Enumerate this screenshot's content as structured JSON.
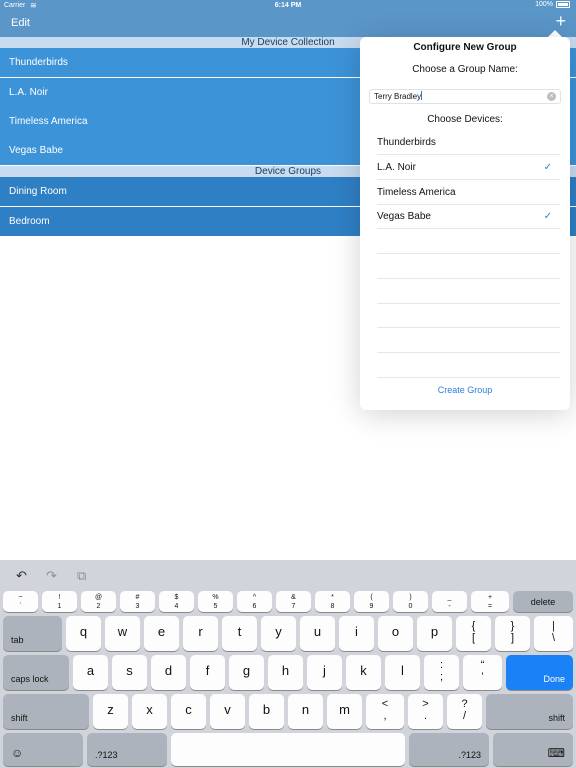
{
  "status_bar": {
    "carrier": "Carrier",
    "time": "6:14 PM",
    "battery": "100%"
  },
  "nav": {
    "edit_label": "Edit",
    "add_label": "+"
  },
  "list": {
    "sections": [
      {
        "header": "My Device Collection",
        "items": [
          "Thunderbirds",
          "L.A. Noir",
          "Timeless America",
          "Vegas Babe"
        ]
      },
      {
        "header": "Device Groups",
        "items": [
          "Dining Room",
          "Bedroom"
        ]
      }
    ]
  },
  "popover": {
    "title": "Configure New Group",
    "name_prompt": "Choose a Group Name:",
    "name_value": "Terry Bradley",
    "devices_prompt": "Choose Devices:",
    "devices": [
      {
        "label": "Thunderbirds",
        "checked": false
      },
      {
        "label": "L.A. Noir",
        "checked": true
      },
      {
        "label": "Timeless America",
        "checked": false
      },
      {
        "label": "Vegas Babe",
        "checked": true
      }
    ],
    "check_glyph": "✓",
    "create_label": "Create Group"
  },
  "keyboard": {
    "tools": {
      "undo_icon": "↶",
      "redo_icon": "↷",
      "paste_icon": "⧉"
    },
    "row1": [
      {
        "top": "~",
        "bot": "`"
      },
      {
        "top": "!",
        "bot": "1"
      },
      {
        "top": "@",
        "bot": "2"
      },
      {
        "top": "#",
        "bot": "3"
      },
      {
        "top": "$",
        "bot": "4"
      },
      {
        "top": "%",
        "bot": "5"
      },
      {
        "top": "^",
        "bot": "6"
      },
      {
        "top": "&",
        "bot": "7"
      },
      {
        "top": "*",
        "bot": "8"
      },
      {
        "top": "(",
        "bot": "9"
      },
      {
        "top": ")",
        "bot": "0"
      },
      {
        "top": "_",
        "bot": "-"
      },
      {
        "top": "+",
        "bot": "="
      }
    ],
    "delete_label": "delete",
    "tab_label": "tab",
    "row2": [
      "q",
      "w",
      "e",
      "r",
      "t",
      "y",
      "u",
      "i",
      "o",
      "p"
    ],
    "row2_sym": [
      {
        "top": "{",
        "bot": "["
      },
      {
        "top": "}",
        "bot": "]"
      },
      {
        "top": "|",
        "bot": "\\"
      }
    ],
    "caps_label": "caps lock",
    "row3": [
      "a",
      "s",
      "d",
      "f",
      "g",
      "h",
      "j",
      "k",
      "l"
    ],
    "row3_sym": [
      {
        "top": ":",
        "bot": ";"
      },
      {
        "top": "“",
        "bot": "’"
      }
    ],
    "done_label": "Done",
    "shift_label": "shift",
    "row4": [
      "z",
      "x",
      "c",
      "v",
      "b",
      "n",
      "m"
    ],
    "row4_sym": [
      {
        "top": "<",
        "bot": ","
      },
      {
        "top": ">",
        "bot": "."
      },
      {
        "top": "?",
        "bot": "/"
      }
    ],
    "emoji_icon": "☺",
    "num_label": ".?123",
    "hide_icon": "⌨"
  },
  "colors": {
    "accent": "#2f7fd8",
    "nav": "#5b96c9",
    "row": "#3d93d8",
    "done": "#1a82f6"
  }
}
